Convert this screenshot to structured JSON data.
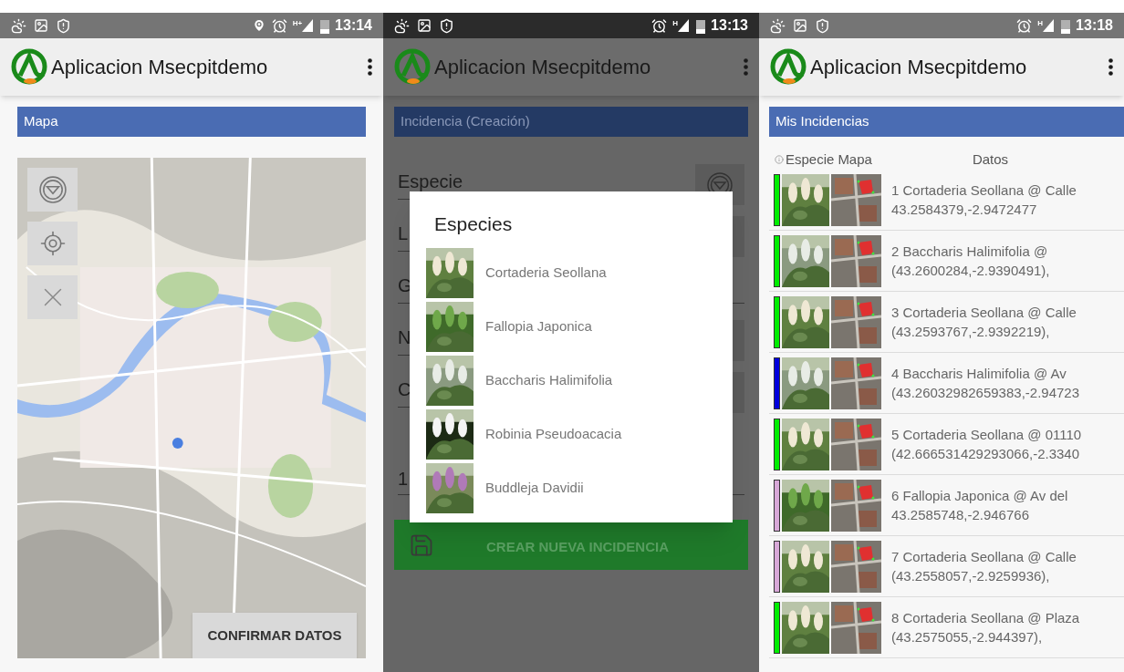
{
  "screens": [
    {
      "kind": "map",
      "dimmed": false,
      "status_bar": {
        "time": "13:14",
        "network": "H+",
        "location": true
      },
      "app_title": "Aplicacion Msecpitdemo",
      "section_title": "Mapa",
      "confirm_button": "CONFIRMAR DATOS"
    },
    {
      "kind": "form",
      "dimmed": true,
      "status_bar": {
        "time": "13:13",
        "network": "H",
        "location": false
      },
      "app_title": "Aplicacion Msecpitdemo",
      "section_title": "Incidencia (Creación)",
      "fields": [
        {
          "label": "Especie",
          "button": true
        },
        {
          "label": "L",
          "button": true
        },
        {
          "label": "G",
          "button": false
        },
        {
          "label": "N",
          "button": true
        },
        {
          "label": "C",
          "button": true
        }
      ],
      "value_field": "1",
      "submit_button": "CREAR NUEVA INCIDENCIA",
      "dialog": {
        "title": "Especies",
        "items": [
          "Cortaderia Seollana",
          "Fallopia Japonica",
          "Baccharis Halimifolia",
          "Robinia Pseudoacacia",
          "Buddleja Davidii"
        ]
      }
    },
    {
      "kind": "list",
      "dimmed": false,
      "status_bar": {
        "time": "13:18",
        "network": "H",
        "location": false
      },
      "app_title": "Aplicacion Msecpitdemo",
      "section_title": "Mis Incidencias",
      "columns": [
        "Especie",
        "Mapa",
        "Datos"
      ],
      "rows": [
        {
          "color": "#00ee00",
          "title": "1 Cortaderia Seollana @ Calle",
          "coordinates": "43.2584379,-2.9472477"
        },
        {
          "color": "#00ee00",
          "title": "2 Baccharis Halimifolia @",
          "coordinates": "(43.2600284,-2.9390491),"
        },
        {
          "color": "#00ee00",
          "title": "3 Cortaderia Seollana @ Calle",
          "coordinates": "(43.2593767,-2.9392219),"
        },
        {
          "color": "#0000dd",
          "title": "4 Baccharis Halimifolia @ Av",
          "coordinates": "(43.26032982659383,-2.94723"
        },
        {
          "color": "#00ee00",
          "title": "5 Cortaderia Seollana @ 01110",
          "coordinates": "(42.666531429293066,-2.3340"
        },
        {
          "color": "#d8a8d8",
          "title": "6 Fallopia Japonica @ Av del",
          "coordinates": "43.2585748,-2.946766"
        },
        {
          "color": "#d8a8d8",
          "title": "7 Cortaderia Seollana @ Calle",
          "coordinates": "(43.2558057,-2.9259936),"
        },
        {
          "color": "#00ee00",
          "title": "8 Cortaderia Seollana @ Plaza",
          "coordinates": "(43.2575055,-2.944397),"
        }
      ]
    }
  ]
}
